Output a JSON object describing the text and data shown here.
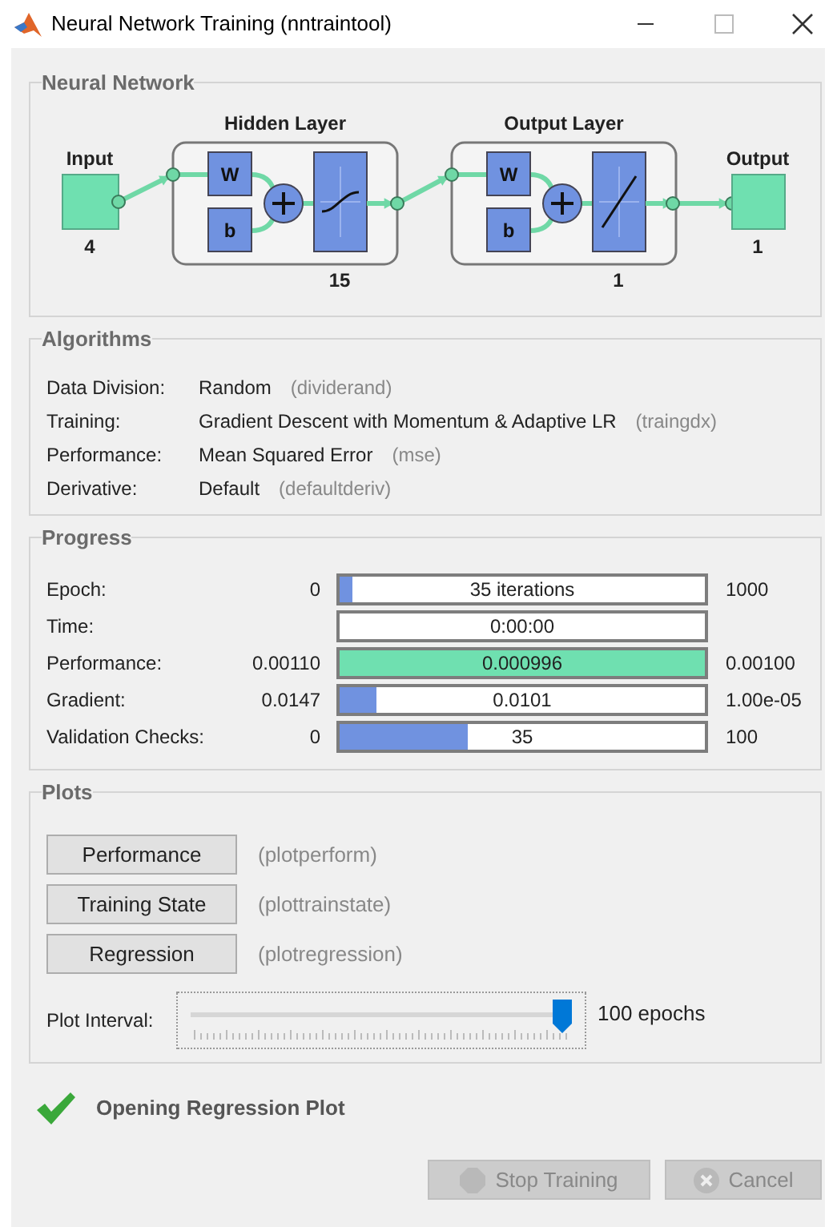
{
  "window": {
    "title": "Neural Network Training (nntraintool)"
  },
  "network": {
    "title": "Neural Network",
    "input": {
      "label": "Input",
      "size": "4"
    },
    "output": {
      "label": "Output",
      "size": "1"
    },
    "layers": [
      {
        "title": "Hidden Layer",
        "weight": "W",
        "bias": "b",
        "size": "15",
        "kind": "sigmoid"
      },
      {
        "title": "Output Layer",
        "weight": "W",
        "bias": "b",
        "size": "1",
        "kind": "linear"
      }
    ]
  },
  "algorithms": {
    "title": "Algorithms",
    "rows": [
      {
        "label": "Data Division:",
        "value": "Random",
        "function": "(dividerand)"
      },
      {
        "label": "Training:",
        "value": "Gradient Descent with Momentum & Adaptive LR",
        "function": "(traingdx)"
      },
      {
        "label": "Performance:",
        "value": "Mean Squared Error",
        "function": "(mse)"
      },
      {
        "label": "Derivative:",
        "value": "Default",
        "function": "(defaultderiv)"
      }
    ]
  },
  "progress": {
    "title": "Progress",
    "rows": [
      {
        "label": "Epoch:",
        "start": "0",
        "reading": "35 iterations",
        "end": "1000",
        "level": 0.035,
        "color": "#7092e0"
      },
      {
        "label": "Time:",
        "reading": "0:00:00",
        "level": 0
      },
      {
        "label": "Performance:",
        "start": "0.00110",
        "reading": "0.000996",
        "end": "0.00100",
        "level": 1,
        "color": "#6fe0b0"
      },
      {
        "label": "Gradient:",
        "start": "0.0147",
        "reading": "0.0101",
        "end": "1.00e-05",
        "level": 0.1,
        "color": "#7092e0"
      },
      {
        "label": "Validation Checks:",
        "start": "0",
        "reading": "35",
        "end": "100",
        "level": 0.35,
        "color": "#7092e0"
      }
    ]
  },
  "plots": {
    "title": "Plots",
    "rows": [
      {
        "button": "Performance",
        "function": "(plotperform)"
      },
      {
        "button": "Training State",
        "function": "(plottrainstate)"
      },
      {
        "button": "Regression",
        "function": "(plotregression)"
      }
    ],
    "interval": {
      "label": "Plot Interval:",
      "level": 1,
      "reading": "100 epochs"
    }
  },
  "status": {
    "text": "Opening Regression Plot"
  },
  "buttons": [
    {
      "label": "Stop Training",
      "kind": "stop",
      "disabled": true
    },
    {
      "label": "Cancel",
      "kind": "cancel",
      "disabled": true
    }
  ]
}
